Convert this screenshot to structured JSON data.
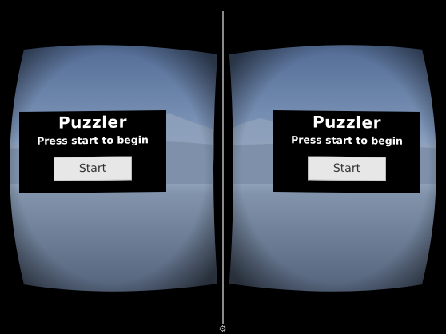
{
  "game": {
    "title": "Puzzler",
    "subtitle": "Press start to begin",
    "start_label": "Start"
  },
  "colors": {
    "background": "#000000",
    "sky_top": "#5b7499",
    "sky_horizon": "#9db0c6",
    "ground": "#7f8fa7",
    "panel": "#000000",
    "button": "#e7e7e7"
  },
  "icons": {
    "settings": "gear-icon"
  }
}
